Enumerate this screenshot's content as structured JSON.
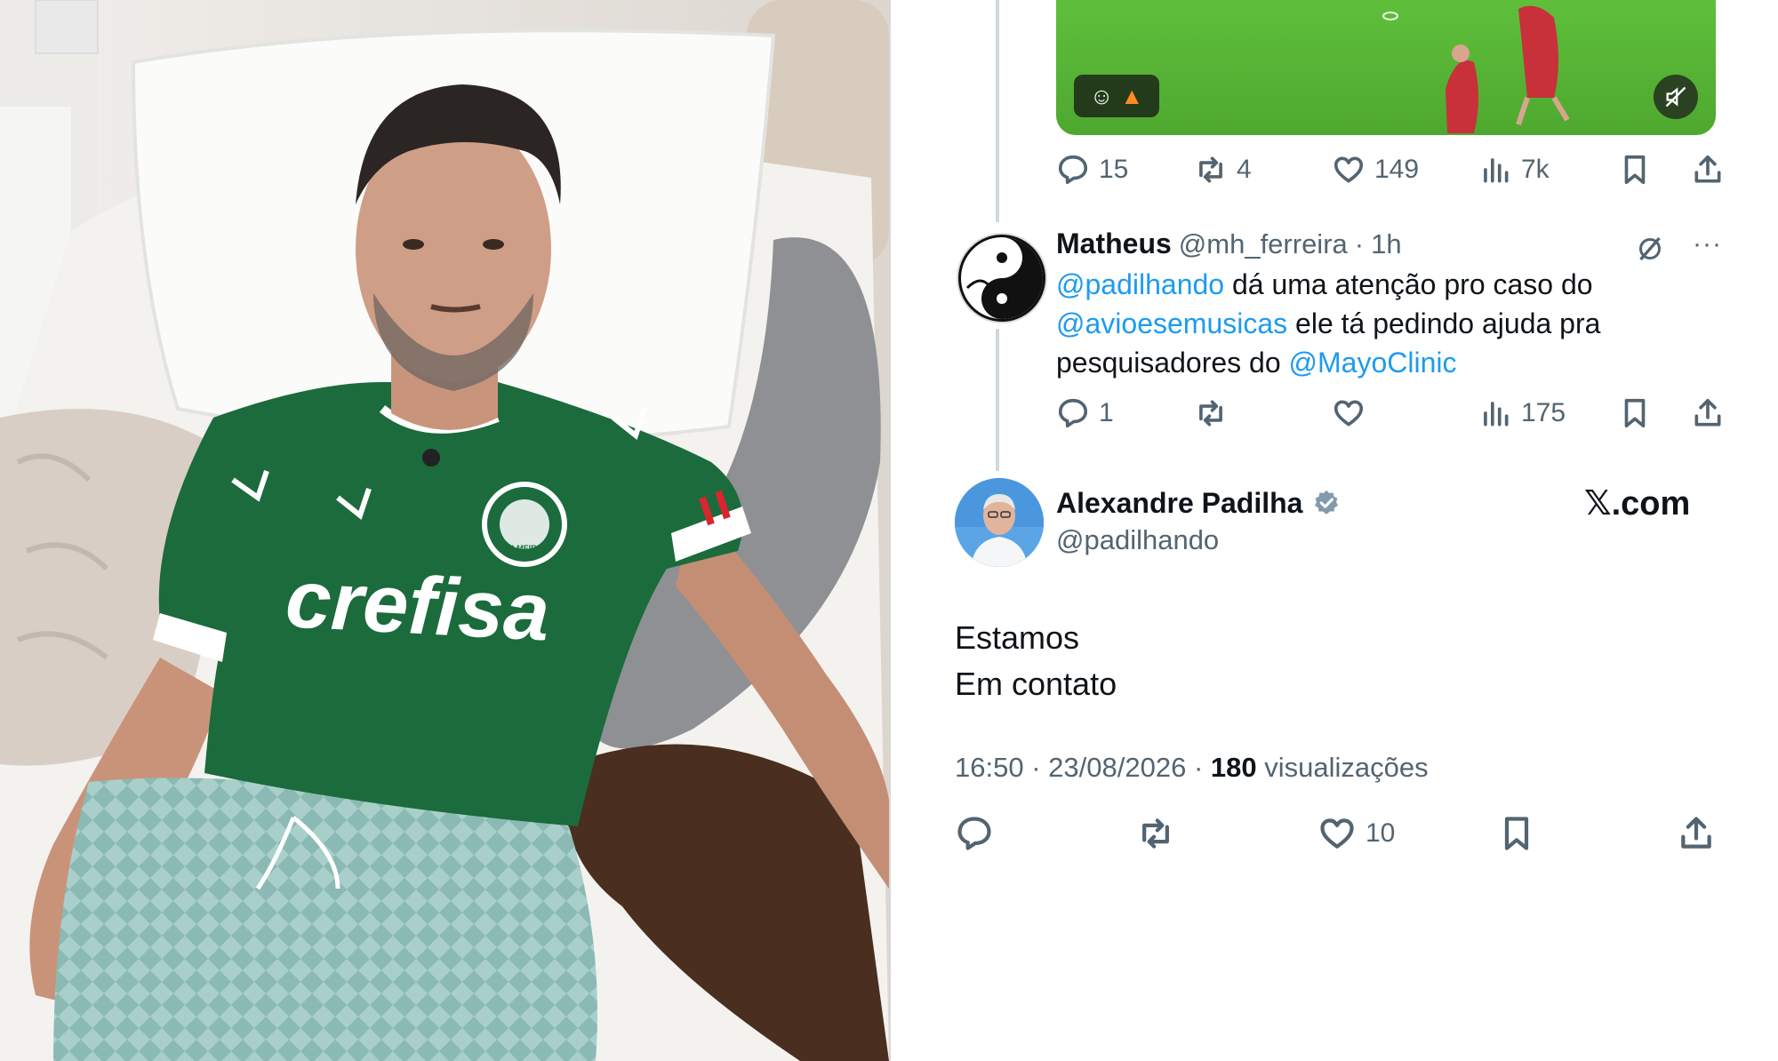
{
  "media_tweet": {
    "stats": {
      "replies": "15",
      "reposts": "4",
      "likes": "149",
      "views": "7k"
    }
  },
  "reply_tweet": {
    "author_name": "Matheus",
    "author_handle": "@mh_ferreira",
    "separator": "·",
    "time": "1h",
    "text_parts": {
      "mention1": "@padilhando",
      "part1": " dá uma atenção pro caso do ",
      "mention2": "@avioesemusicas",
      "part2": " ele tá pedindo ajuda pra pesquisadores do ",
      "mention3": "@MayoClinic"
    },
    "stats": {
      "replies": "1",
      "views": "175"
    }
  },
  "main_tweet": {
    "author_name": "Alexandre Padilha",
    "author_handle": "@padilhando",
    "verified": true,
    "brand": "𝕏.com",
    "text_line1": "Estamos",
    "text_line2": "Em contato",
    "time": "16:50",
    "date": "23/08/2026",
    "sep": "·",
    "views_count": "180",
    "views_label": "visualizações",
    "likes": "10"
  },
  "photo": {
    "jersey_sponsor": "crefisa",
    "badge_text": "PALMEIRAS"
  },
  "colors": {
    "link": "#1d9bf0",
    "secondary": "#536471",
    "verified": "#829aab",
    "jersey": "#1b6b3c"
  }
}
